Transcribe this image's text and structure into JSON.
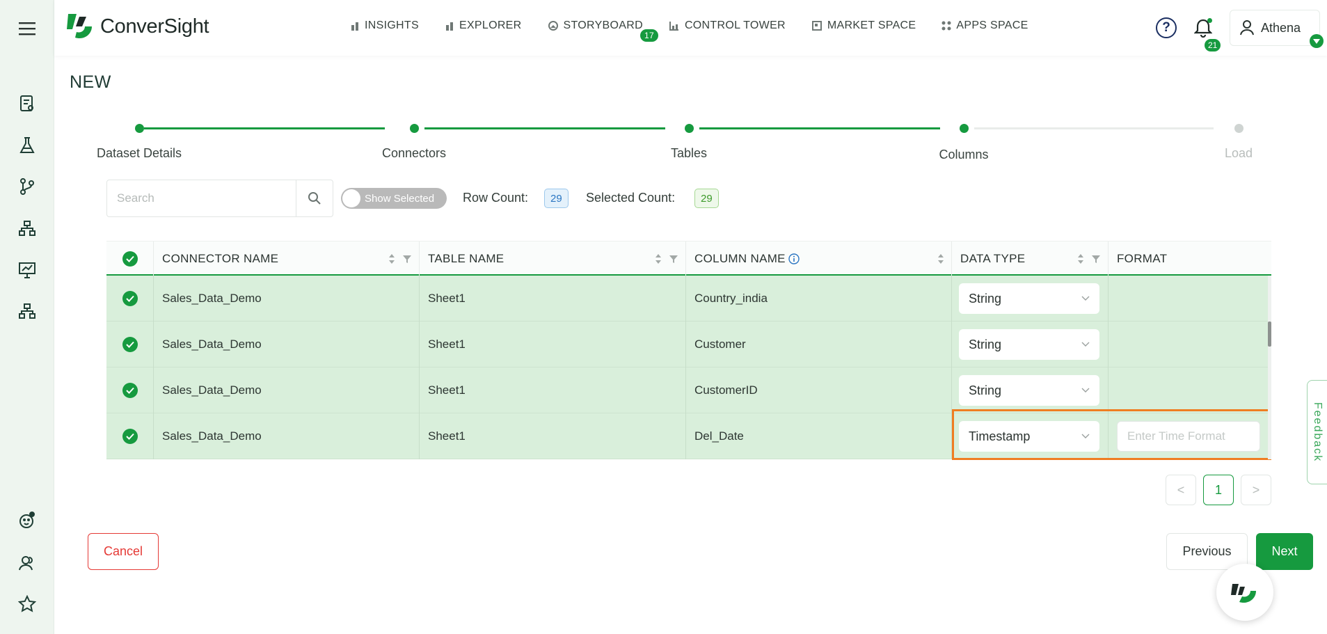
{
  "app": {
    "logo_text": "ConverSight"
  },
  "nav": [
    {
      "label": "INSIGHTS",
      "icon": "bar-chart-icon"
    },
    {
      "label": "EXPLORER",
      "icon": "bar-chart-icon"
    },
    {
      "label": "STORYBOARD",
      "icon": "storyboard-icon",
      "badge": "17"
    },
    {
      "label": "CONTROL TOWER",
      "icon": "control-tower-icon"
    },
    {
      "label": "MARKET SPACE",
      "icon": "market-space-icon"
    },
    {
      "label": "APPS SPACE",
      "icon": "apps-grid-icon"
    }
  ],
  "header": {
    "notification_count": "21",
    "user_name": "Athena",
    "help_glyph": "?"
  },
  "page": {
    "title": "NEW"
  },
  "stepper": {
    "steps": [
      {
        "label": "Dataset Details",
        "status": "done"
      },
      {
        "label": "Connectors",
        "status": "done"
      },
      {
        "label": "Tables",
        "status": "done"
      },
      {
        "label": "Columns",
        "status": "current"
      },
      {
        "label": "Load",
        "status": "pending"
      }
    ]
  },
  "toolbar": {
    "search_placeholder": "Search",
    "toggle_label": "Show Selected",
    "row_count_label": "Row Count:",
    "row_count": "29",
    "selected_count_label": "Selected Count:",
    "selected_count": "29"
  },
  "table": {
    "columns": [
      "CONNECTOR NAME",
      "TABLE NAME",
      "COLUMN NAME",
      "DATA TYPE",
      "FORMAT"
    ],
    "rows": [
      {
        "connector": "Sales_Data_Demo",
        "table": "Sheet1",
        "column": "Country_india",
        "type": "String",
        "format": ""
      },
      {
        "connector": "Sales_Data_Demo",
        "table": "Sheet1",
        "column": "Customer",
        "type": "String",
        "format": ""
      },
      {
        "connector": "Sales_Data_Demo",
        "table": "Sheet1",
        "column": "CustomerID",
        "type": "String",
        "format": ""
      },
      {
        "connector": "Sales_Data_Demo",
        "table": "Sheet1",
        "column": "Del_Date",
        "type": "Timestamp",
        "format_placeholder": "Enter Time Format"
      }
    ]
  },
  "pagination": {
    "current_page": "1",
    "prev": "<",
    "next": ">"
  },
  "footer": {
    "cancel_label": "Cancel",
    "previous_label": "Previous",
    "next_label": "Next"
  },
  "feedback_label": "Feedback",
  "colors": {
    "brand": "#169a3f",
    "row_bg": "#d9efdb",
    "highlight": "#ef7d22",
    "cancel": "#e53935"
  }
}
